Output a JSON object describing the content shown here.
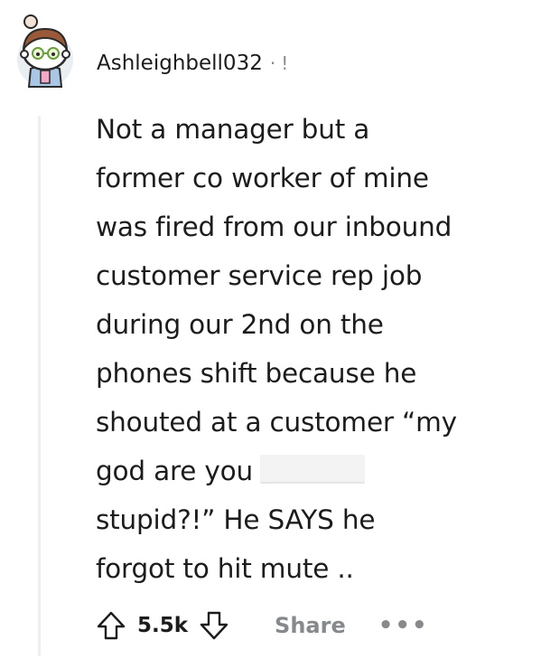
{
  "comment": {
    "author": "Ashleighbell032",
    "separator": "·",
    "flair_mark": "!",
    "body_lines": [
      "Not a manager but a",
      "former co worker of mine",
      "was fired from our inbound",
      "customer service rep job",
      "during our 2nd on the",
      "phones shift because he",
      "shouted at a customer “my",
      "god are you",
      "stupid?!” He SAYS he",
      "forgot to hit mute .."
    ]
  },
  "actions": {
    "score": "5.5k",
    "share_label": "Share",
    "more_label": "•••"
  },
  "icons": {
    "avatar": "snoo-avatar",
    "upvote": "upvote-arrow-icon",
    "downvote": "downvote-arrow-icon"
  },
  "colors": {
    "text": "#1c1c1c",
    "muted": "#878a8c",
    "thread_line": "#edeff1"
  }
}
